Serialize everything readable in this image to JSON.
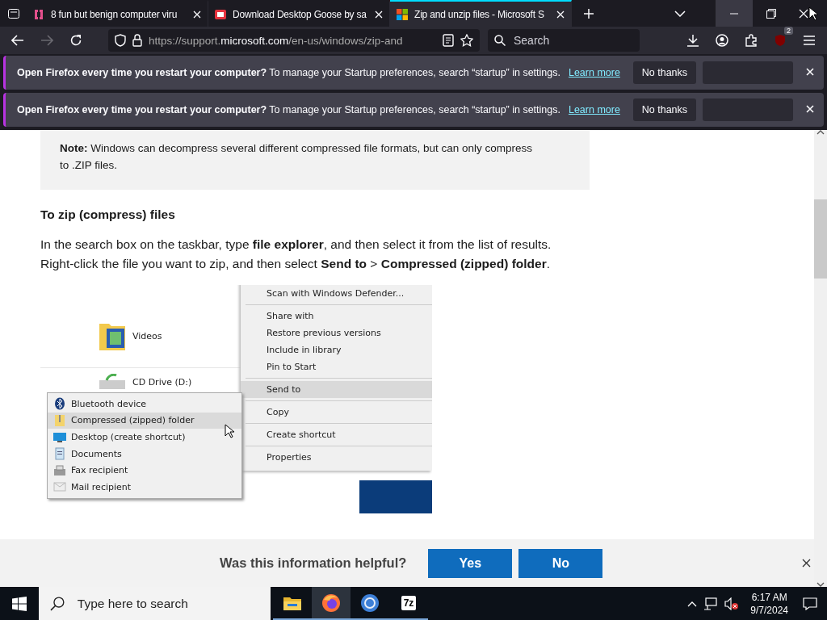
{
  "tabs": [
    {
      "title": "8 fun but benign computer viru",
      "selected": false
    },
    {
      "title": "Download Desktop Goose by sa",
      "selected": false
    },
    {
      "title": "Zip and unzip files - Microsoft S",
      "selected": true
    }
  ],
  "nav": {
    "back_disabled": false,
    "forward_disabled": true,
    "url": {
      "scheme": "https://support.",
      "host": "microsoft.com",
      "path": "/en-us/windows/zip-and"
    },
    "search_placeholder": "Search",
    "extension_badge": "2"
  },
  "notifications": [
    {
      "message": "**Open Firefox every time you restart your computer?** To manage your Startup preferences, search “startup” in settings.",
      "link": "Learn more",
      "button": "No thanks"
    },
    {
      "message": "**Open Firefox every time you restart your computer?** To manage your Startup preferences, search “startup” in settings.",
      "link": "Learn more",
      "button": "No thanks"
    }
  ],
  "article": {
    "note": "**Note:** Windows can decompress several different compressed file formats, but can only compress to .ZIP files.",
    "heading": "To zip (compress) files",
    "paragraph": "In the search box on the taskbar, type **file explorer**, and then select it from the list of results. Right-click the file you want to zip, and then select **Send to** > **Compressed (zipped) folder**.",
    "screenshot": {
      "explorer_items": [
        {
          "label": "Videos"
        },
        {
          "label": "CD Drive (D:)"
        }
      ],
      "context_menu": [
        [
          {
            "label": "Scan with Windows Defender...",
            "selected": false
          }
        ],
        [
          {
            "label": "Share with",
            "selected": false
          },
          {
            "label": "Restore previous versions",
            "selected": false
          },
          {
            "label": "Include in library",
            "selected": false
          },
          {
            "label": "Pin to Start",
            "selected": false
          }
        ],
        [
          {
            "label": "Send to",
            "selected": true
          }
        ],
        [
          {
            "label": "Copy",
            "selected": false
          }
        ],
        [
          {
            "label": "Create shortcut",
            "selected": false
          }
        ],
        [
          {
            "label": "Properties",
            "selected": false
          }
        ]
      ],
      "send_to_menu": [
        {
          "label": "Bluetooth device",
          "selected": false
        },
        {
          "label": "Compressed (zipped) folder",
          "selected": true
        },
        {
          "label": "Desktop (create shortcut)",
          "selected": false
        },
        {
          "label": "Documents",
          "selected": false
        },
        {
          "label": "Fax recipient",
          "selected": false
        },
        {
          "label": "Mail recipient",
          "selected": false
        }
      ]
    }
  },
  "feedback": {
    "question": "Was this information helpful?",
    "buttons": [
      "Yes",
      "No"
    ]
  },
  "taskbar": {
    "search_placeholder": "Type here to search",
    "apps": [
      {
        "selected": false
      },
      {
        "selected": true
      },
      {
        "selected": false
      },
      {
        "selected": false,
        "label": "7z"
      }
    ],
    "time": "6:17 AM",
    "date": "9/7/2024"
  }
}
